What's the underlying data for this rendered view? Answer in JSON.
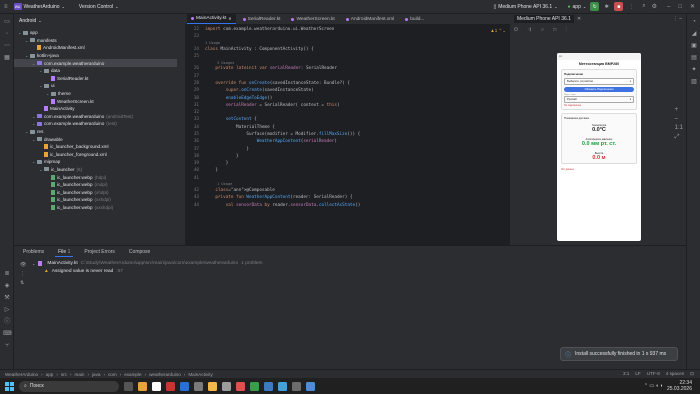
{
  "titlebar": {
    "project_badge": "WA",
    "project": "WeatherArduino",
    "vcs": "Version Control",
    "device": "Medium Phone API 36.1",
    "run_config": "app"
  },
  "project_panel": {
    "view": "Android",
    "tree": [
      {
        "label": "app",
        "depth": 0,
        "type": "folder"
      },
      {
        "label": "manifests",
        "depth": 1,
        "type": "folder"
      },
      {
        "label": "AndroidManifest.xml",
        "depth": 2,
        "type": "file"
      },
      {
        "label": "kotlin+java",
        "depth": 1,
        "type": "folder"
      },
      {
        "label": "com.example.weatherarduino",
        "depth": 2,
        "type": "pkg",
        "selected": true
      },
      {
        "label": "data",
        "depth": 3,
        "type": "folder"
      },
      {
        "label": "SerialReader.kt",
        "depth": 4,
        "type": "kt"
      },
      {
        "label": "ui",
        "depth": 3,
        "type": "folder"
      },
      {
        "label": "theme",
        "depth": 4,
        "type": "folder"
      },
      {
        "label": "WeatherScreen.kt",
        "depth": 4,
        "type": "kt"
      },
      {
        "label": "MainActivity",
        "depth": 3,
        "type": "kt"
      },
      {
        "label": "com.example.weatherarduino",
        "suffix": "(androidTest)",
        "depth": 2,
        "type": "pkg"
      },
      {
        "label": "com.example.weatherarduino",
        "suffix": "(test)",
        "depth": 2,
        "type": "pkg"
      },
      {
        "label": "res",
        "depth": 1,
        "type": "folder"
      },
      {
        "label": "drawable",
        "depth": 2,
        "type": "folder"
      },
      {
        "label": "ic_launcher_background.xml",
        "depth": 3,
        "type": "file"
      },
      {
        "label": "ic_launcher_foreground.xml",
        "depth": 3,
        "type": "file"
      },
      {
        "label": "mipmap",
        "depth": 2,
        "type": "folder"
      },
      {
        "label": "ic_launcher",
        "suffix": "(6)",
        "depth": 3,
        "type": "folder"
      },
      {
        "label": "ic_launcher.webp",
        "suffix": "(hdpi)",
        "depth": 4,
        "type": "png"
      },
      {
        "label": "ic_launcher.webp",
        "suffix": "(mdpi)",
        "depth": 4,
        "type": "png"
      },
      {
        "label": "ic_launcher.webp",
        "suffix": "(xhdpi)",
        "depth": 4,
        "type": "png"
      },
      {
        "label": "ic_launcher.webp",
        "suffix": "(xxhdpi)",
        "depth": 4,
        "type": "png"
      },
      {
        "label": "ic_launcher.webp",
        "suffix": "(xxxhdpi)",
        "depth": 4,
        "type": "png"
      }
    ]
  },
  "editor": {
    "tabs": [
      "MainActivity.kt",
      "SerialReader.kt",
      "WeatherScreen.kt",
      "AndroidManifest.xml",
      "build..."
    ],
    "usage1": "1 Usage",
    "usage2": "3 Usages",
    "usage3": "1 Usage",
    "lines": [
      {
        "n": "22",
        "t": "import com.example.weatherarduino.ui.WeatherScreen"
      },
      {
        "n": "23",
        "t": ""
      },
      {
        "n": "24",
        "t": "class MainActivity : ComponentActivity() {"
      },
      {
        "n": "25",
        "t": ""
      },
      {
        "n": "26",
        "t": "    private lateinit var serialReader: SerialReader"
      },
      {
        "n": "27",
        "t": ""
      },
      {
        "n": "28",
        "t": "    override fun onCreate(savedInstanceState: Bundle?) {"
      },
      {
        "n": "29",
        "t": "        super.onCreate(savedInstanceState)"
      },
      {
        "n": "30",
        "t": "        enableEdgeToEdge()"
      },
      {
        "n": "31",
        "t": "        serialReader = SerialReader( context = this)"
      },
      {
        "n": "32",
        "t": ""
      },
      {
        "n": "33",
        "t": "        setContent {"
      },
      {
        "n": "34",
        "t": "            MaterialTheme {"
      },
      {
        "n": "35",
        "t": "                Surface(modifier = Modifier.fillMaxSize()) {"
      },
      {
        "n": "36",
        "t": "                    WeatherAppContent(serialReader)"
      },
      {
        "n": "37",
        "t": "                }"
      },
      {
        "n": "38",
        "t": "            }"
      },
      {
        "n": "39",
        "t": "        }"
      },
      {
        "n": "40",
        "t": "    }"
      },
      {
        "n": "41",
        "t": ""
      },
      {
        "n": "42",
        "t": "    @Composable"
      },
      {
        "n": "43",
        "t": "    private fun WeatherAppContent(reader: SerialReader) {"
      },
      {
        "n": "44",
        "t": "        val sensorData by reader.sensorData.collectAsState()"
      }
    ]
  },
  "emulator": {
    "tab": "Medium Phone API 36.1",
    "app_title": "Метеостанция BMP280",
    "connect_title": "Подключение",
    "device_select": "Выберите устройство",
    "refresh_btn": "Обновить Подключения",
    "port_label": "Порт / язык",
    "lang": "Русский",
    "status": "Не подключено",
    "section": "Показания датчика",
    "temp_label": "Температура",
    "temp_value": "0.0°C",
    "press_label": "Атмосферное давление",
    "press_value": "0.0 мм рт. ст.",
    "alt_label": "Высота",
    "alt_value": "0.0 м",
    "footer": "Нет данных"
  },
  "bottom": {
    "tabs": [
      "Problems",
      "File",
      "Project Errors",
      "Compose"
    ],
    "file_count": "1",
    "file": "MainActivity.kt",
    "path": "C:\\Study\\WeatherArduino\\app\\src\\main\\java\\com\\example\\weatherarduino",
    "problems": "1 problem",
    "warning": "Assigned value is never read",
    "warning_loc": ":57"
  },
  "toast": "Install successfully finished in 1 s 937 ms",
  "status": {
    "crumbs": [
      "WeatherArduino",
      "app",
      "src",
      "main",
      "java",
      "com",
      "example",
      "weatherarduino",
      "MainActivity"
    ],
    "pos": "3:1",
    "lf": "LF",
    "enc": "UTF-8",
    "indent": "4 spaces"
  },
  "taskbar": {
    "search": "Поиск",
    "time": "22:34",
    "date": "25.03.2026"
  }
}
